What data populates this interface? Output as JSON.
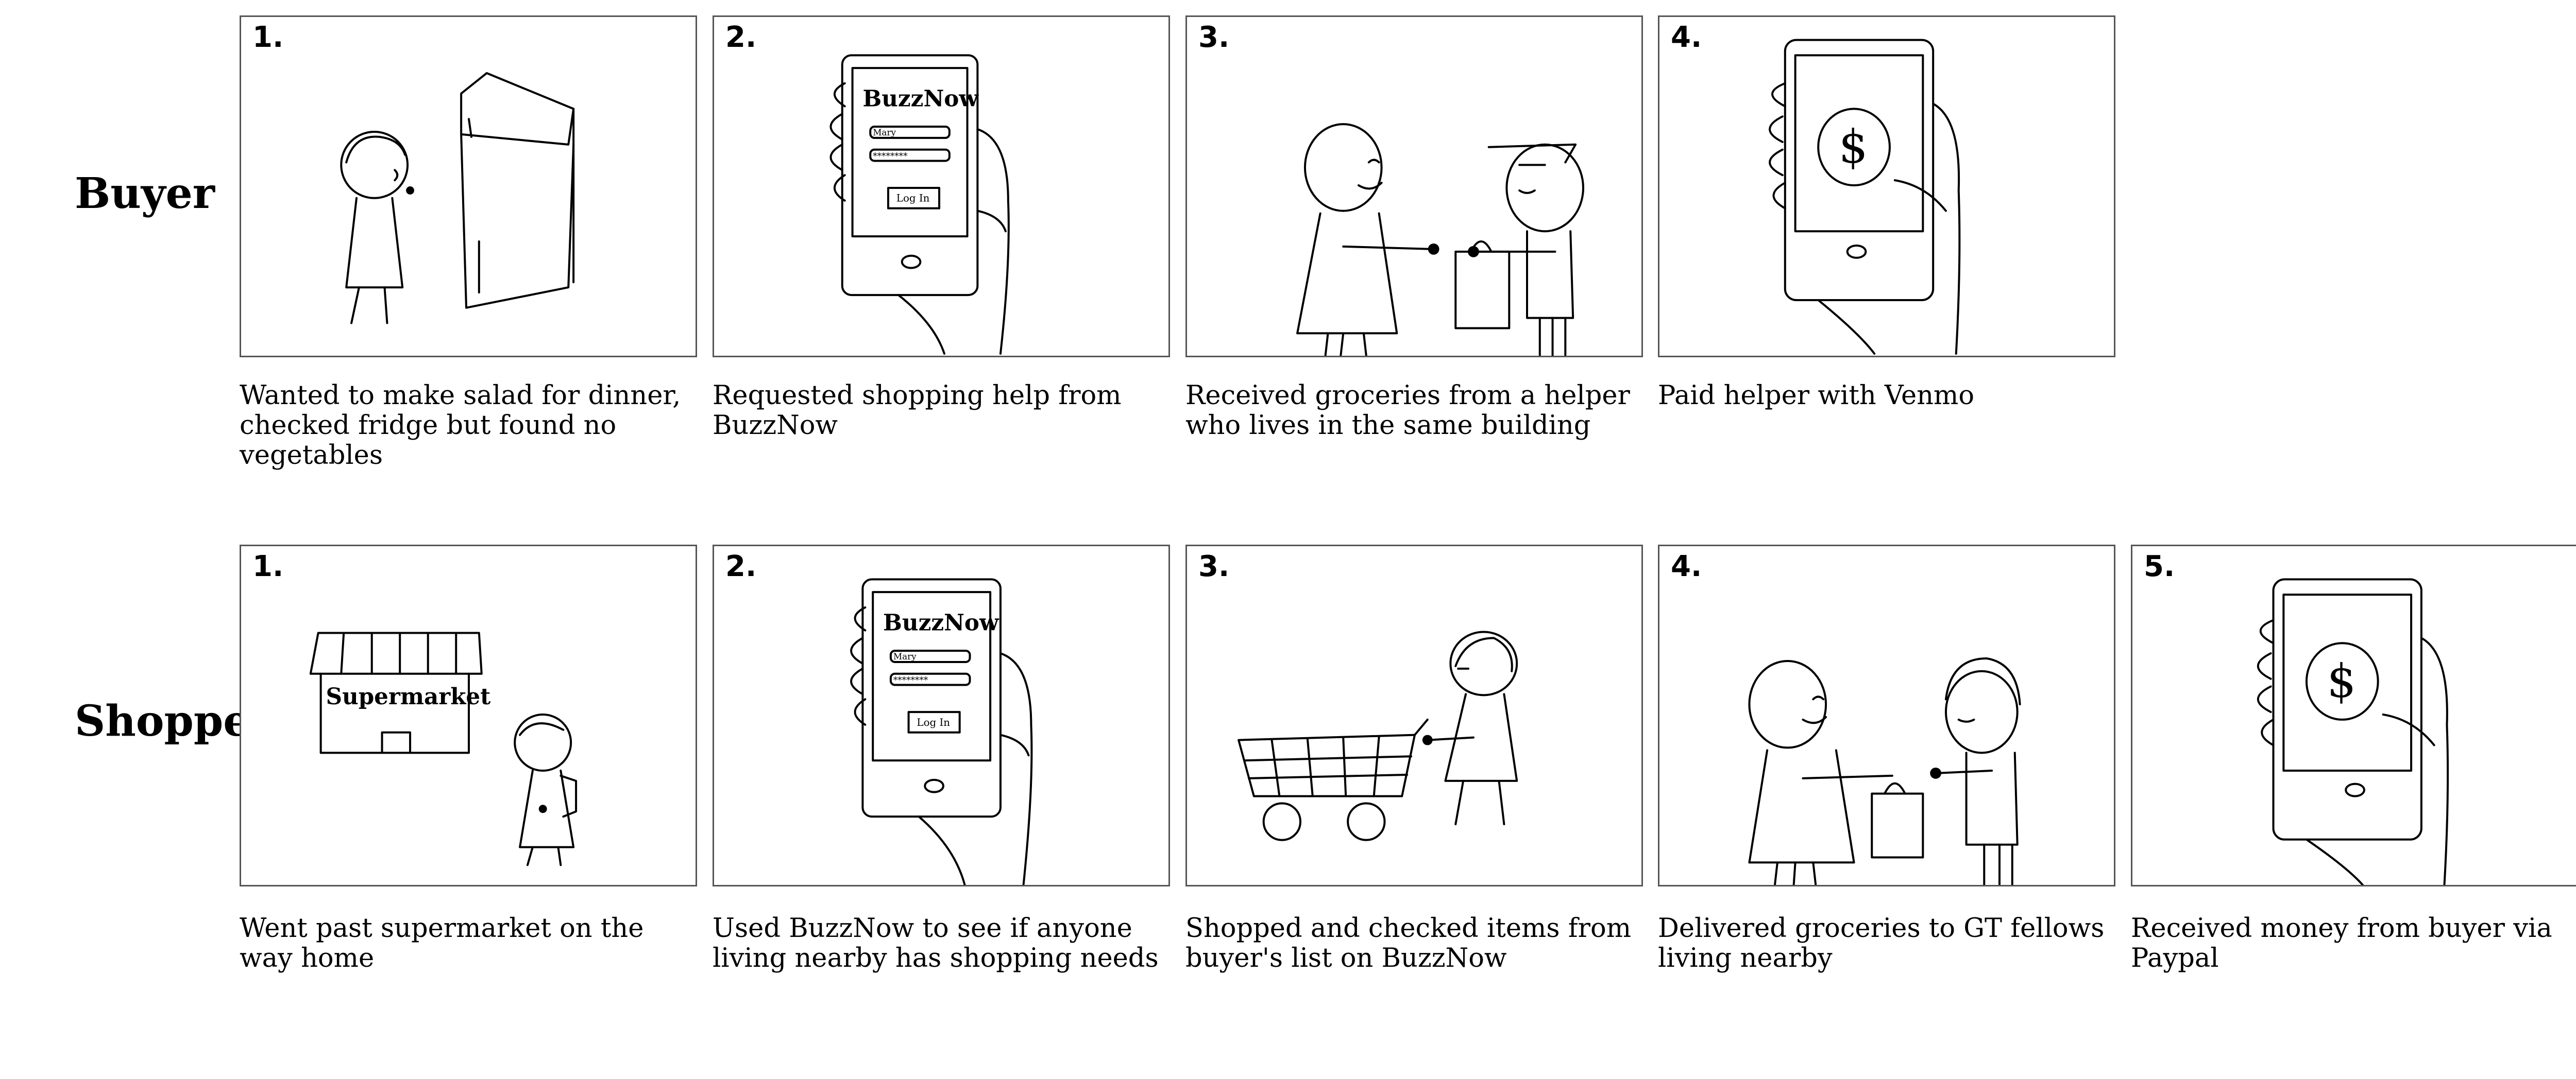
{
  "rows": [
    {
      "label": "Buyer",
      "panels": [
        {
          "number": "1.",
          "caption": "Wanted to make salad for dinner, checked fridge but found no vegetables"
        },
        {
          "number": "2.",
          "caption": "Requested shopping help from BuzzNow",
          "app_name": "BuzzNow",
          "username": "Mary",
          "password": "********",
          "button": "Log In"
        },
        {
          "number": "3.",
          "caption": "Received groceries from a helper who lives in the same building"
        },
        {
          "number": "4.",
          "caption": "Paid helper with Venmo",
          "symbol": "$"
        }
      ]
    },
    {
      "label": "Shopper",
      "panels": [
        {
          "number": "1.",
          "caption": "Went past supermarket on the way home",
          "store_sign": "Supermarket"
        },
        {
          "number": "2.",
          "caption": "Used BuzzNow to see if anyone living nearby has shopping needs",
          "app_name": "BuzzNow",
          "username": "Mary",
          "password": "********",
          "button": "Log In"
        },
        {
          "number": "3.",
          "caption": "Shopped and checked items from buyer's list on BuzzNow"
        },
        {
          "number": "4.",
          "caption": "Delivered groceries to GT fellows living nearby"
        },
        {
          "number": "5.",
          "caption": "Received money from buyer via Paypal",
          "symbol": "$"
        }
      ]
    }
  ]
}
